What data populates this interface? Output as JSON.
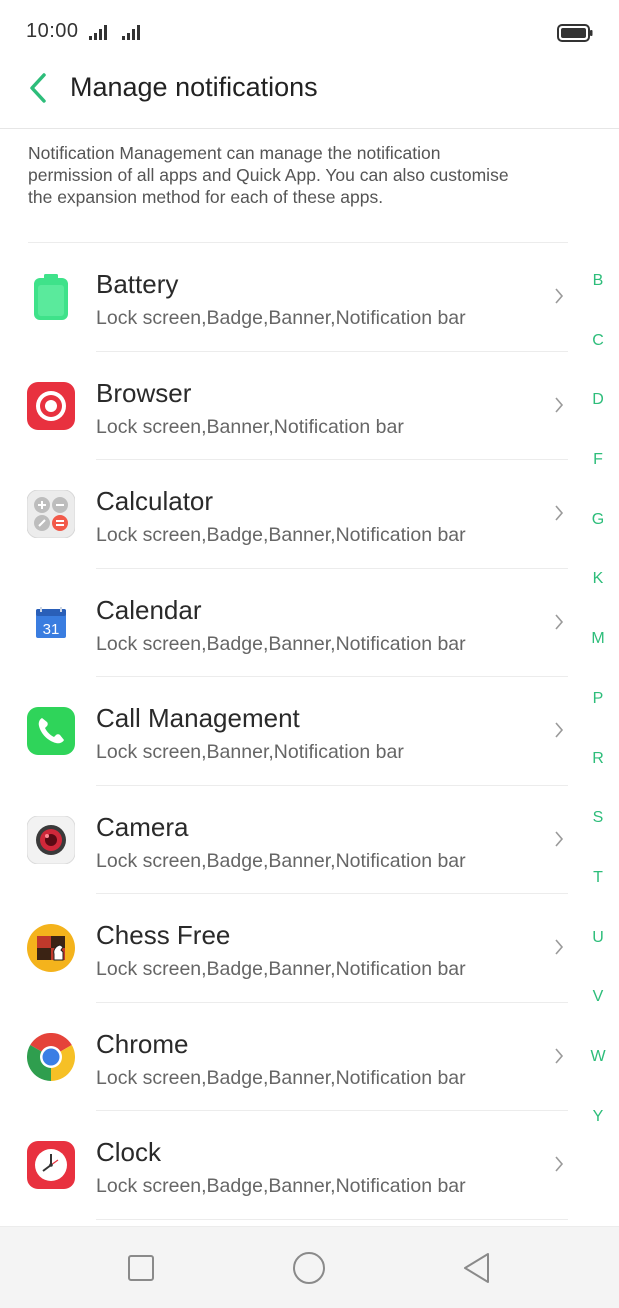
{
  "status_bar": {
    "time": "10:00"
  },
  "header": {
    "title": "Manage notifications",
    "back_icon": "chevron-left-icon"
  },
  "description": "Notification Management can manage the notification permission of all apps and Quick App. You can also customise the expansion method for each of these apps.",
  "apps": [
    {
      "name": "Battery",
      "sub": "Lock screen,Badge,Banner,Notification bar",
      "icon": "battery-app-icon"
    },
    {
      "name": "Browser",
      "sub": "Lock screen,Banner,Notification bar",
      "icon": "browser-app-icon"
    },
    {
      "name": "Calculator",
      "sub": "Lock screen,Badge,Banner,Notification bar",
      "icon": "calculator-app-icon"
    },
    {
      "name": "Calendar",
      "sub": "Lock screen,Badge,Banner,Notification bar",
      "icon": "calendar-app-icon",
      "icon_text": "31"
    },
    {
      "name": "Call Management",
      "sub": "Lock screen,Banner,Notification bar",
      "icon": "phone-app-icon"
    },
    {
      "name": "Camera",
      "sub": "Lock screen,Badge,Banner,Notification bar",
      "icon": "camera-app-icon"
    },
    {
      "name": "Chess Free",
      "sub": "Lock screen,Badge,Banner,Notification bar",
      "icon": "chess-app-icon"
    },
    {
      "name": "Chrome",
      "sub": "Lock screen,Badge,Banner,Notification bar",
      "icon": "chrome-app-icon"
    },
    {
      "name": "Clock",
      "sub": "Lock screen,Badge,Banner,Notification bar",
      "icon": "clock-app-icon"
    }
  ],
  "alphabet_index": [
    "B",
    "C",
    "D",
    "F",
    "G",
    "K",
    "M",
    "P",
    "R",
    "S",
    "T",
    "U",
    "V",
    "W",
    "Y"
  ],
  "nav": {
    "recents_icon": "square-recents-icon",
    "home_icon": "circle-home-icon",
    "back_icon": "triangle-back-icon"
  },
  "colors": {
    "accent": "#2dbd7a",
    "text_primary": "#2a2a2a",
    "text_secondary": "#666666"
  }
}
